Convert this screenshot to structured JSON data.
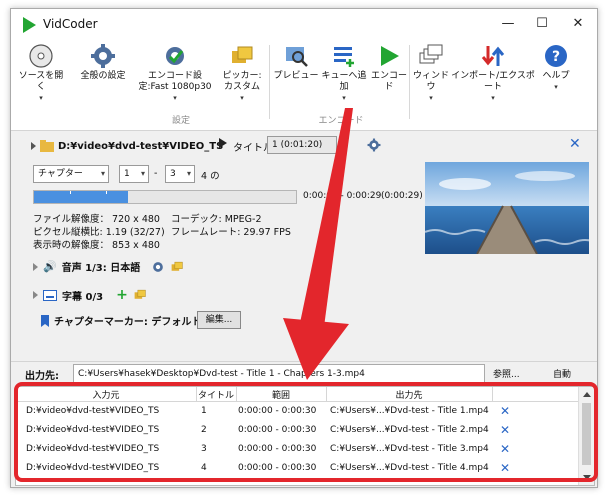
{
  "window": {
    "title": "VidCoder",
    "minimize": "—",
    "maximize": "☐",
    "close": "✕"
  },
  "ribbon": {
    "buttons": [
      {
        "label": "ソースを開く",
        "icon": "disc-icon"
      },
      {
        "label": "全般の設定",
        "icon": "gear-icon"
      },
      {
        "label": "エンコード設定:Fast 1080p30",
        "icon": "gear-check-icon"
      },
      {
        "label": "ピッカー: カスタム",
        "icon": "folders-icon"
      },
      {
        "label": "プレビュー",
        "icon": "magnifier-icon"
      },
      {
        "label": "キューへ追加",
        "icon": "add-queue-icon"
      },
      {
        "label": "エンコード",
        "icon": "play-icon"
      },
      {
        "label": "ウィンドウ",
        "icon": "windows-icon"
      },
      {
        "label": "インポート/エクスポート",
        "icon": "import-export-icon"
      },
      {
        "label": "ヘルプ",
        "icon": "help-icon"
      }
    ],
    "groups": {
      "settings": "設定",
      "encode": "エンコード"
    }
  },
  "source": {
    "path": "D:¥video¥dvd-test¥VIDEO_TS",
    "title_label": "タイトル:",
    "title_value": "1 (0:01:20)"
  },
  "range": {
    "mode": "チャプター",
    "start": "1",
    "dash": "-",
    "end": "3",
    "count_suffix": "4 の",
    "progress_fraction": 0.36,
    "time_range": "0:00:00 - 0:00:29",
    "duration": "(0:00:29)"
  },
  "info": {
    "file_resolution": "ファイル解像度： 720 x 480",
    "pixel_aspect": "ピクセル縦横比: 1.19 (32/27)",
    "display_resolution": "表示時の解像度： 853 x 480",
    "codec": "コーデック: MPEG-2",
    "framerate": "フレームレート: 29.97 FPS"
  },
  "audio": {
    "label": "音声 1/3: 日本語"
  },
  "subtitles": {
    "label": "字幕 0/3",
    "add": "+"
  },
  "chapters": {
    "label": "チャプターマーカー: デフォルト",
    "edit": "編集..."
  },
  "output": {
    "label": "出力先:",
    "path": "C:¥Users¥hasek¥Desktop¥Dvd-test - Title 1 - Chapters 1-3.mp4",
    "browse": "参照...",
    "auto": "自動"
  },
  "queue": {
    "headers": [
      "入力元",
      "タイトル",
      "範囲",
      "出力先"
    ],
    "rows": [
      {
        "source": "D:¥video¥dvd-test¥VIDEO_TS",
        "title": "1",
        "range": "0:00:00 - 0:00:30",
        "dest": "C:¥Users¥...¥Dvd-test - Title 1.mp4",
        "remove": "✕"
      },
      {
        "source": "D:¥video¥dvd-test¥VIDEO_TS",
        "title": "2",
        "range": "0:00:00 - 0:00:30",
        "dest": "C:¥Users¥...¥Dvd-test - Title 2.mp4",
        "remove": "✕"
      },
      {
        "source": "D:¥video¥dvd-test¥VIDEO_TS",
        "title": "3",
        "range": "0:00:00 - 0:00:30",
        "dest": "C:¥Users¥...¥Dvd-test - Title 3.mp4",
        "remove": "✕"
      },
      {
        "source": "D:¥video¥dvd-test¥VIDEO_TS",
        "title": "4",
        "range": "0:00:00 - 0:00:30",
        "dest": "C:¥Users¥...¥Dvd-test - Title 4.mp4",
        "remove": "✕"
      }
    ]
  },
  "colors": {
    "accent": "#2a66c5",
    "highlight": "#e3262c",
    "encode_green": "#22a532"
  }
}
